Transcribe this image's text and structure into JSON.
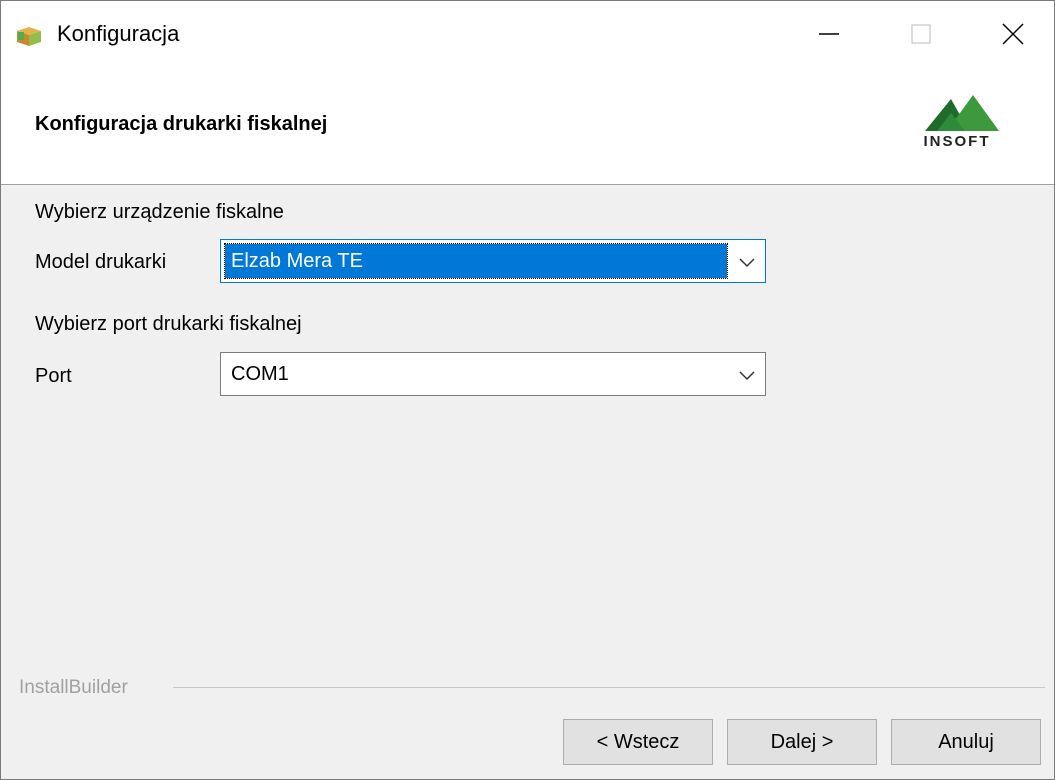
{
  "window": {
    "title": "Konfiguracja",
    "icon": "installer-box-icon",
    "controls": [
      "minimize-icon",
      "maximize-icon",
      "close-icon"
    ]
  },
  "header": {
    "title": "Konfiguracja drukarki fiskalnej",
    "logo_text": "INSOFT"
  },
  "device_section": {
    "heading": "Wybierz urządzenie fiskalne",
    "model_label": "Model drukarki",
    "model_value": "Elzab Mera TE"
  },
  "port_section": {
    "heading": "Wybierz port drukarki fiskalnej",
    "port_label": "Port",
    "port_value": "COM1"
  },
  "footer": {
    "group_label": "InstallBuilder",
    "back_label": "< Wstecz",
    "next_label": "Dalej >",
    "cancel_label": "Anuluj"
  },
  "colors": {
    "selection": "#0078d7",
    "logo_green": "#3c9a3c",
    "logo_dark_green": "#1f6b2a"
  }
}
